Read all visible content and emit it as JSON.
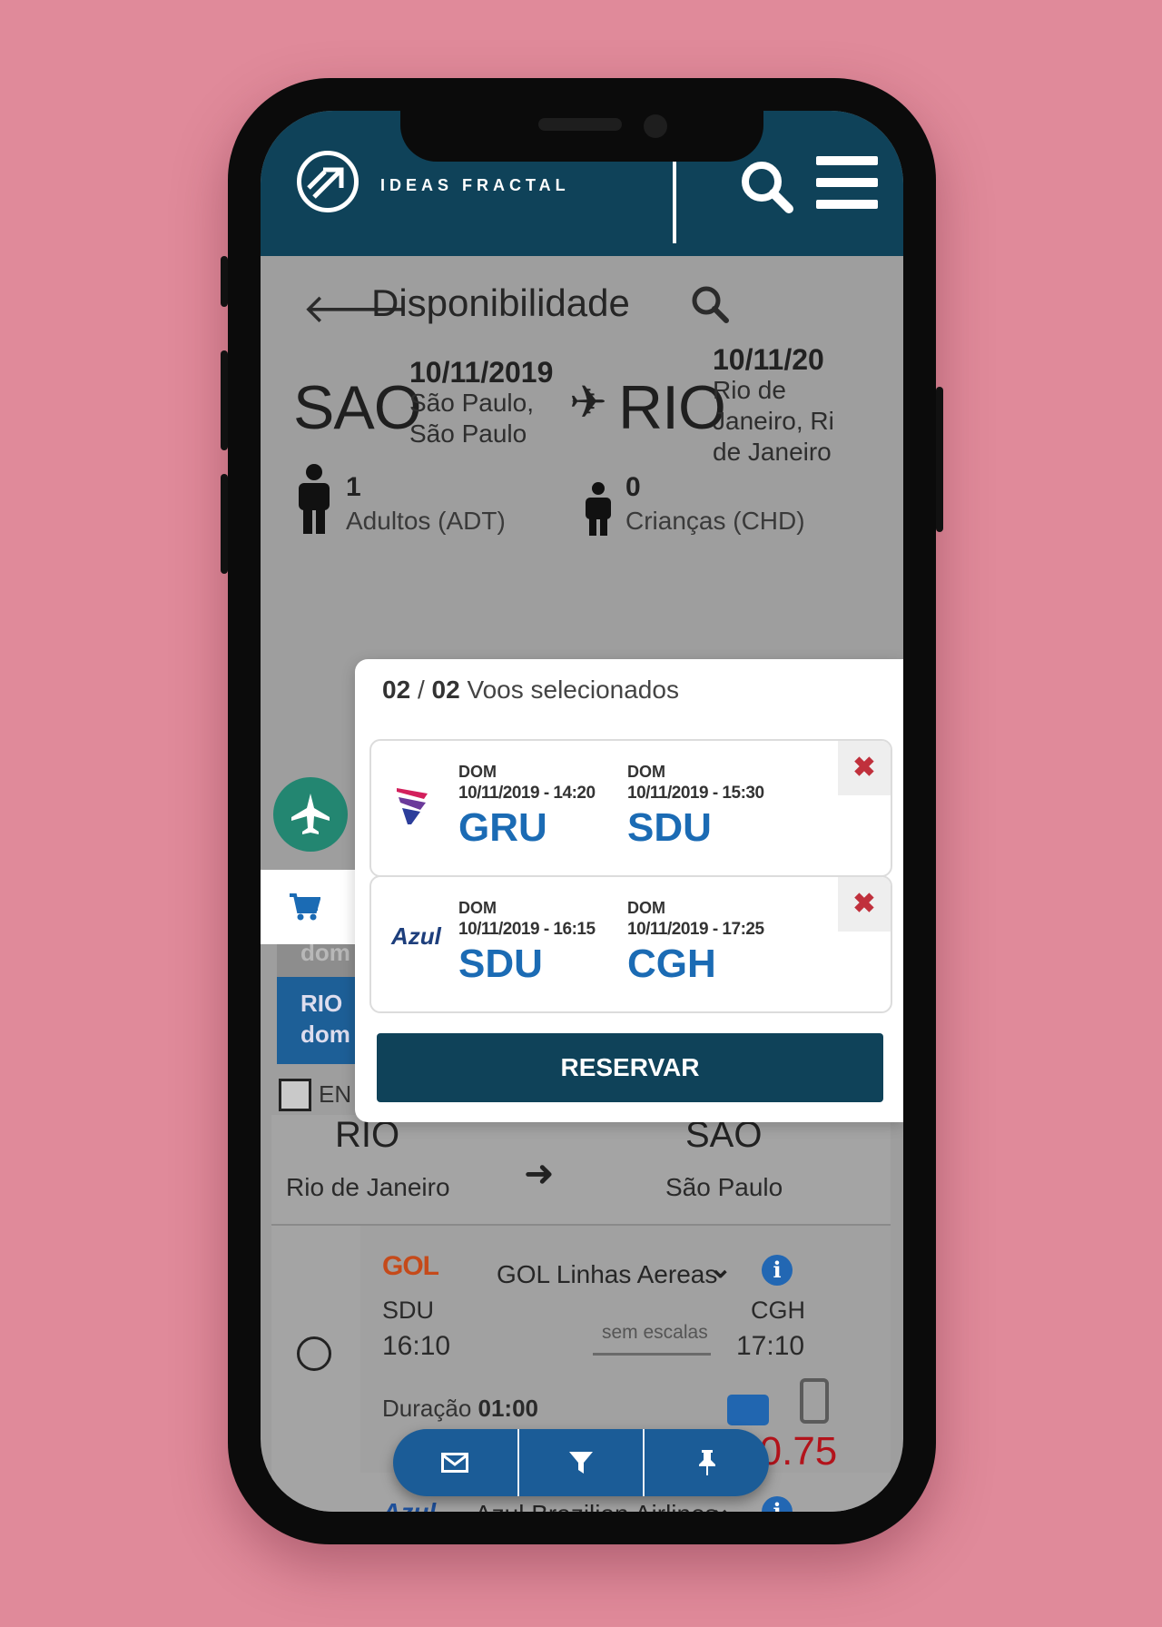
{
  "header": {
    "brand": "IDEAS FRACTAL"
  },
  "page": {
    "title": "Disponibilidade",
    "back_icon": "arrow-left-icon",
    "search_icon": "search-icon"
  },
  "route": {
    "origin_code": "SAO",
    "origin_date": "10/11/2019",
    "origin_city_1": "São Paulo,",
    "origin_city_2": "São Paulo",
    "destination_code": "RIO",
    "destination_date": "10/11/20",
    "destination_city_1": "Rio de",
    "destination_city_2": "Janeiro, Ri",
    "destination_city_3": "de Janeiro",
    "arrow_glyph": "✈"
  },
  "passengers": {
    "adults_count": "1",
    "adults_label": "Adultos (ADT)",
    "children_count": "0",
    "children_label": "Crianças (CHD)"
  },
  "background_panel": {
    "grey_tab": "dom",
    "blue_tab_line1": "RIO",
    "blue_tab_line2": "dom",
    "checkbox_label": "EN"
  },
  "return_leg": {
    "origin_code": "RIO",
    "origin_city": "Rio de Janeiro",
    "destination_code": "SAO",
    "destination_city": "São Paulo",
    "arrow_glyph": "➜"
  },
  "flight_option": {
    "airline_logo": "GOL",
    "airline_name": "GOL Linhas Aereas",
    "from_code": "SDU",
    "from_time": "16:10",
    "to_code": "CGH",
    "to_time": "17:10",
    "stops": "sem escalas",
    "duration_label": "Duração",
    "duration_value": "01:00",
    "price": "1.190.75"
  },
  "next_option": {
    "airline_logo": "Azul",
    "airline_name": "Azul Brazilian Airlines"
  },
  "popup": {
    "selected": "02",
    "separator": "/",
    "total": "02",
    "label": "Voos selecionados",
    "flights": [
      {
        "airline": "LATAM",
        "dep_day": "DOM",
        "dep_datetime": "10/11/2019 - 14:20",
        "dep_code": "GRU",
        "arr_day": "DOM",
        "arr_datetime": "10/11/2019 - 15:30",
        "arr_code": "SDU",
        "remove": "✖"
      },
      {
        "airline": "Azul",
        "dep_day": "DOM",
        "dep_datetime": "10/11/2019 - 16:15",
        "dep_code": "SDU",
        "arr_day": "DOM",
        "arr_datetime": "10/11/2019 - 17:25",
        "arr_code": "CGH",
        "remove": "✖"
      }
    ],
    "reserve_label": "RESERVAR"
  },
  "fab": {
    "icons": [
      "envelope-icon",
      "filter-icon",
      "pin-icon"
    ]
  },
  "colors": {
    "background": "#e08a9a",
    "header": "#0f4259",
    "accent_blue": "#1b6bb4",
    "price_red": "#b3131b",
    "remove_red": "#c0303c",
    "green": "#238671"
  }
}
